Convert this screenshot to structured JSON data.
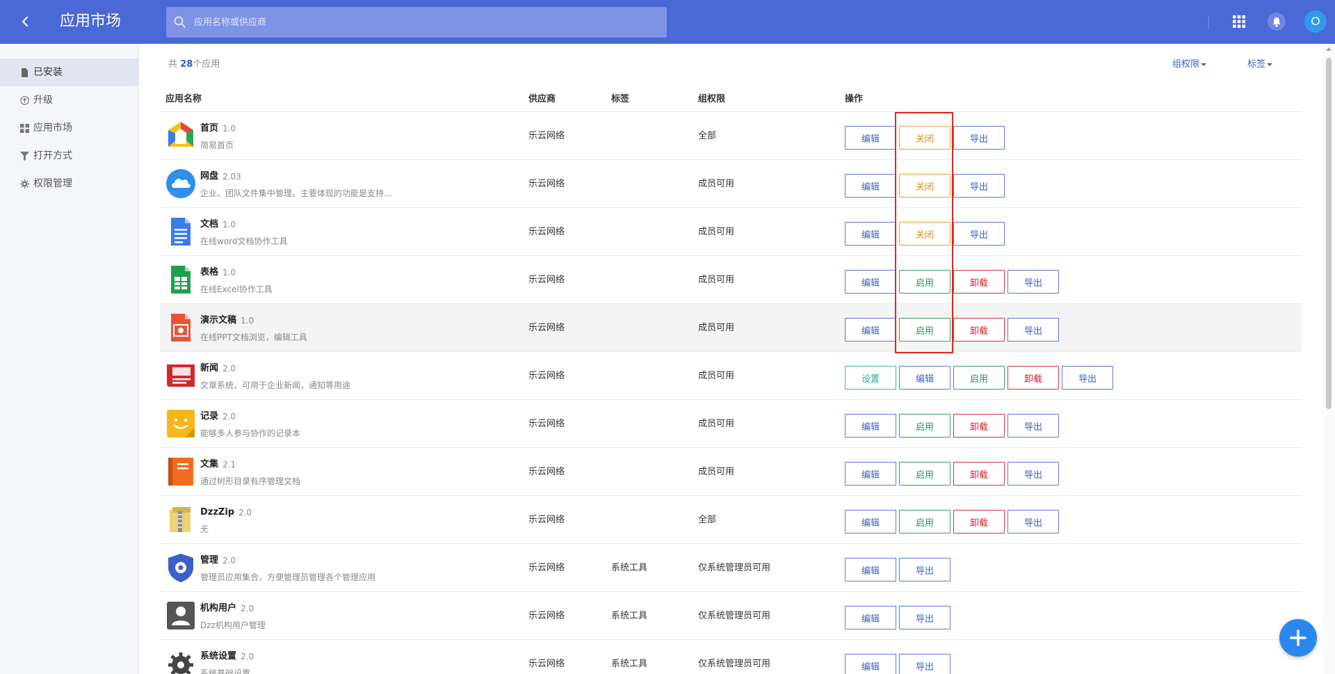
{
  "header": {
    "title": "应用市场",
    "search_placeholder": "应用名称或供应商",
    "avatar_letter": "O",
    "color": "#4a68d6"
  },
  "sidebar": {
    "items": [
      {
        "label": "已安装",
        "icon": "file-icon",
        "active": true
      },
      {
        "label": "升级",
        "icon": "upgrade-icon",
        "active": false
      },
      {
        "label": "应用市场",
        "icon": "grid-icon",
        "active": false
      },
      {
        "label": "打开方式",
        "icon": "filter-icon",
        "active": false
      },
      {
        "label": "权限管理",
        "icon": "gear-icon",
        "active": false
      }
    ]
  },
  "summary": {
    "prefix": "共",
    "count": "28",
    "suffix": "个应用"
  },
  "filters": {
    "group_permission": "组权限",
    "tag": "标签"
  },
  "table": {
    "columns": [
      "应用名称",
      "供应商",
      "标签",
      "组权限",
      "操作"
    ],
    "rows": [
      {
        "name": "首页",
        "version": "1.0",
        "desc": "简易首页",
        "vendor": "乐云网络",
        "tag": "",
        "permission": "全部",
        "icon": "homepage-icon",
        "buttons": [
          {
            "label": "编辑",
            "type": "edit"
          },
          {
            "label": "关闭",
            "type": "close"
          },
          {
            "label": "导出",
            "type": "export"
          }
        ]
      },
      {
        "name": "网盘",
        "version": "2.03",
        "desc": "企业、团队文件集中管理。主要体现的功能是支持...",
        "vendor": "乐云网络",
        "tag": "",
        "permission": "成员可用",
        "icon": "cloud-drive-icon",
        "buttons": [
          {
            "label": "编辑",
            "type": "edit"
          },
          {
            "label": "关闭",
            "type": "close"
          },
          {
            "label": "导出",
            "type": "export"
          }
        ]
      },
      {
        "name": "文档",
        "version": "1.0",
        "desc": "在线word文档协作工具",
        "vendor": "乐云网络",
        "tag": "",
        "permission": "成员可用",
        "icon": "document-icon",
        "buttons": [
          {
            "label": "编辑",
            "type": "edit"
          },
          {
            "label": "关闭",
            "type": "close"
          },
          {
            "label": "导出",
            "type": "export"
          }
        ]
      },
      {
        "name": "表格",
        "version": "1.0",
        "desc": "在线Excel协作工具",
        "vendor": "乐云网络",
        "tag": "",
        "permission": "成员可用",
        "icon": "spreadsheet-icon",
        "buttons": [
          {
            "label": "编辑",
            "type": "edit"
          },
          {
            "label": "启用",
            "type": "enable"
          },
          {
            "label": "卸载",
            "type": "uninstall"
          },
          {
            "label": "导出",
            "type": "export"
          }
        ]
      },
      {
        "name": "演示文稿",
        "version": "1.0",
        "desc": "在线PPT文档浏览，编辑工具",
        "vendor": "乐云网络",
        "tag": "",
        "permission": "成员可用",
        "icon": "presentation-icon",
        "buttons": [
          {
            "label": "编辑",
            "type": "edit"
          },
          {
            "label": "启用",
            "type": "enable"
          },
          {
            "label": "卸载",
            "type": "uninstall"
          },
          {
            "label": "导出",
            "type": "export"
          }
        ]
      },
      {
        "name": "新闻",
        "version": "2.0",
        "desc": "文章系统，可用于企业新闻，通知等用途",
        "vendor": "乐云网络",
        "tag": "",
        "permission": "成员可用",
        "icon": "news-icon",
        "buttons": [
          {
            "label": "设置",
            "type": "settings"
          },
          {
            "label": "编辑",
            "type": "edit"
          },
          {
            "label": "启用",
            "type": "enable"
          },
          {
            "label": "卸载",
            "type": "uninstall"
          },
          {
            "label": "导出",
            "type": "export"
          }
        ]
      },
      {
        "name": "记录",
        "version": "2.0",
        "desc": "能够多人参与协作的记录本",
        "vendor": "乐云网络",
        "tag": "",
        "permission": "成员可用",
        "icon": "note-icon",
        "buttons": [
          {
            "label": "编辑",
            "type": "edit"
          },
          {
            "label": "启用",
            "type": "enable"
          },
          {
            "label": "卸载",
            "type": "uninstall"
          },
          {
            "label": "导出",
            "type": "export"
          }
        ]
      },
      {
        "name": "文集",
        "version": "2.1",
        "desc": "通过树形目录有序管理文档",
        "vendor": "乐云网络",
        "tag": "",
        "permission": "成员可用",
        "icon": "book-icon",
        "buttons": [
          {
            "label": "编辑",
            "type": "edit"
          },
          {
            "label": "启用",
            "type": "enable"
          },
          {
            "label": "卸载",
            "type": "uninstall"
          },
          {
            "label": "导出",
            "type": "export"
          }
        ]
      },
      {
        "name": "DzzZip",
        "version": "2.0",
        "desc": "无",
        "vendor": "乐云网络",
        "tag": "",
        "permission": "全部",
        "icon": "zip-archive-icon",
        "buttons": [
          {
            "label": "编辑",
            "type": "edit"
          },
          {
            "label": "启用",
            "type": "enable"
          },
          {
            "label": "卸载",
            "type": "uninstall"
          },
          {
            "label": "导出",
            "type": "export"
          }
        ]
      },
      {
        "name": "管理",
        "version": "2.0",
        "desc": "管理员应用集合，方便管理员管理各个管理应用",
        "vendor": "乐云网络",
        "tag": "系统工具",
        "permission": "仅系统管理员可用",
        "icon": "admin-shield-icon",
        "buttons": [
          {
            "label": "编辑",
            "type": "edit"
          },
          {
            "label": "导出",
            "type": "export"
          }
        ]
      },
      {
        "name": "机构用户",
        "version": "2.0",
        "desc": "Dzz机构用户管理",
        "vendor": "乐云网络",
        "tag": "系统工具",
        "permission": "仅系统管理员可用",
        "icon": "user-icon",
        "buttons": [
          {
            "label": "编辑",
            "type": "edit"
          },
          {
            "label": "导出",
            "type": "export"
          }
        ]
      },
      {
        "name": "系统设置",
        "version": "2.0",
        "desc": "系统基础设置",
        "vendor": "乐云网络",
        "tag": "系统工具",
        "permission": "仅系统管理员可用",
        "icon": "settings-gear-icon",
        "buttons": [
          {
            "label": "编辑",
            "type": "edit"
          },
          {
            "label": "导出",
            "type": "export"
          }
        ]
      }
    ]
  }
}
